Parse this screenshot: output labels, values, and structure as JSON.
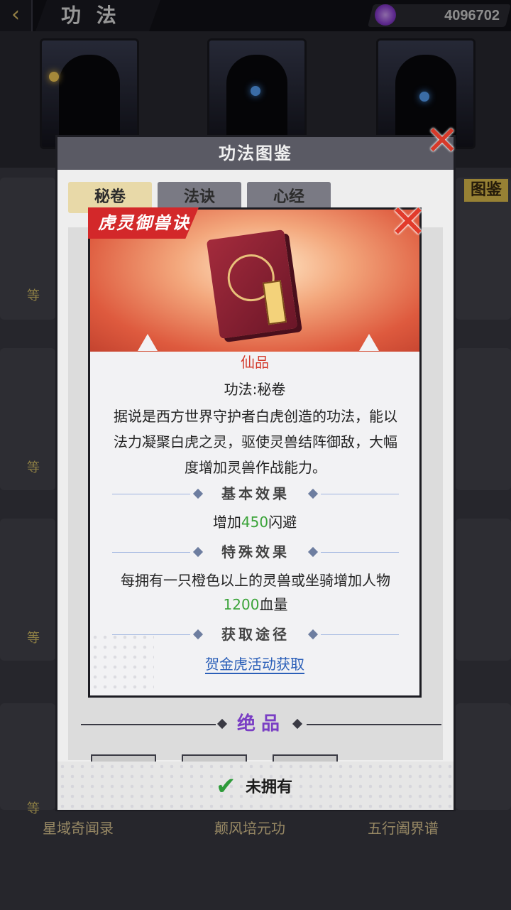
{
  "top_bar": {
    "title": "功 法",
    "currency_value": "4096702"
  },
  "background": {
    "side_tab_right": "图鉴",
    "bottom_items": [
      "星域奇闻录",
      "颠风培元功",
      "五行阖界谱"
    ],
    "side_labels": [
      "等",
      "等",
      "等",
      "等"
    ]
  },
  "outer_dialog": {
    "title": "功法图鉴",
    "tabs": [
      "秘卷",
      "法诀",
      "心经"
    ],
    "grade_section": "绝品",
    "footer_label": "未拥有"
  },
  "popup": {
    "title": "虎灵御兽诀",
    "grade": "仙品",
    "type": "功法:秘卷",
    "description": "据说是西方世界守护者白虎创造的功法，能以法力凝聚白虎之灵，驱使灵兽结阵御敌，大幅度增加灵兽作战能力。",
    "basic_effect_title": "基本效果",
    "basic_effect_prefix": "增加",
    "basic_effect_value": "450",
    "basic_effect_suffix": "闪避",
    "special_effect_title": "特殊效果",
    "special_effect_prefix": "每拥有一只橙色以上的灵兽或坐骑增加人物",
    "special_effect_value": "1200",
    "special_effect_suffix": "血量",
    "acquire_title": "获取途径",
    "acquire_link": "贺金虎活动获取"
  },
  "colors": {
    "highlight": "#3aa338",
    "grade_red": "#d33a2c",
    "link_blue": "#2b5fb8",
    "title_tag_red": "#d3282a"
  }
}
